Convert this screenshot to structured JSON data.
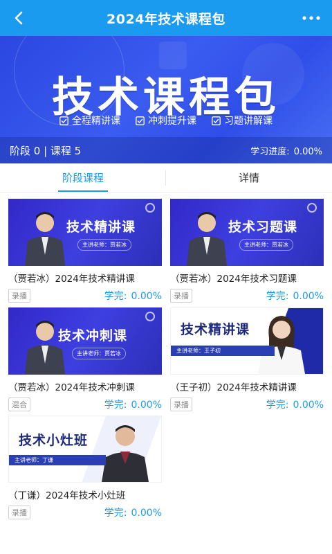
{
  "header": {
    "title": "2024年技术课程包",
    "back_icon": "back-arrow-icon",
    "more_icon": "more-dots-icon"
  },
  "banner": {
    "big_title": "技术课程包",
    "features": [
      "全程精讲课",
      "冲刺提升课",
      "习题讲解课"
    ],
    "stage_count": "阶段 0 | 课程 5",
    "progress_label": "学习进度:",
    "progress_value": "0.00%"
  },
  "tabs": [
    {
      "label": "阶段课程",
      "active": true
    },
    {
      "label": "详情",
      "active": false
    }
  ],
  "courses": [
    {
      "thumb_title": "技术精讲课",
      "thumb_teacher": "主讲老师：贾若冰",
      "name": "（贾若冰）2024年技术精讲课",
      "type": "录播",
      "learned_label": "学完:",
      "learned_value": "0.00%"
    },
    {
      "thumb_title": "技术习题课",
      "thumb_teacher": "主讲老师：贾若冰",
      "name": "（贾若冰）2024年技术习题课",
      "type": "录播",
      "learned_label": "学完:",
      "learned_value": "0.00%"
    },
    {
      "thumb_title": "技术冲刺课",
      "thumb_teacher": "主讲老师：贾若冰",
      "name": "（贾若冰）2024年技术冲刺课",
      "type": "混合",
      "learned_label": "学完:",
      "learned_value": "0.00%"
    },
    {
      "thumb_title": "技术精讲课",
      "thumb_teacher": "主讲老师：王子初",
      "name": "（王子初）2024年技术精讲课",
      "type": "录播",
      "learned_label": "学完:",
      "learned_value": "0.00%"
    },
    {
      "thumb_title": "技术小灶班",
      "thumb_teacher": "主讲老师：丁谦",
      "name": "（丁谦）2024年技术小灶班",
      "type": "录播",
      "learned_label": "学完:",
      "learned_value": "0.00%"
    }
  ],
  "colors": {
    "accent": "#1a9bf0",
    "banner": "#3b5cf0",
    "thumb_dark": "#3328c8",
    "thumb_navy": "#1f2a7a"
  }
}
